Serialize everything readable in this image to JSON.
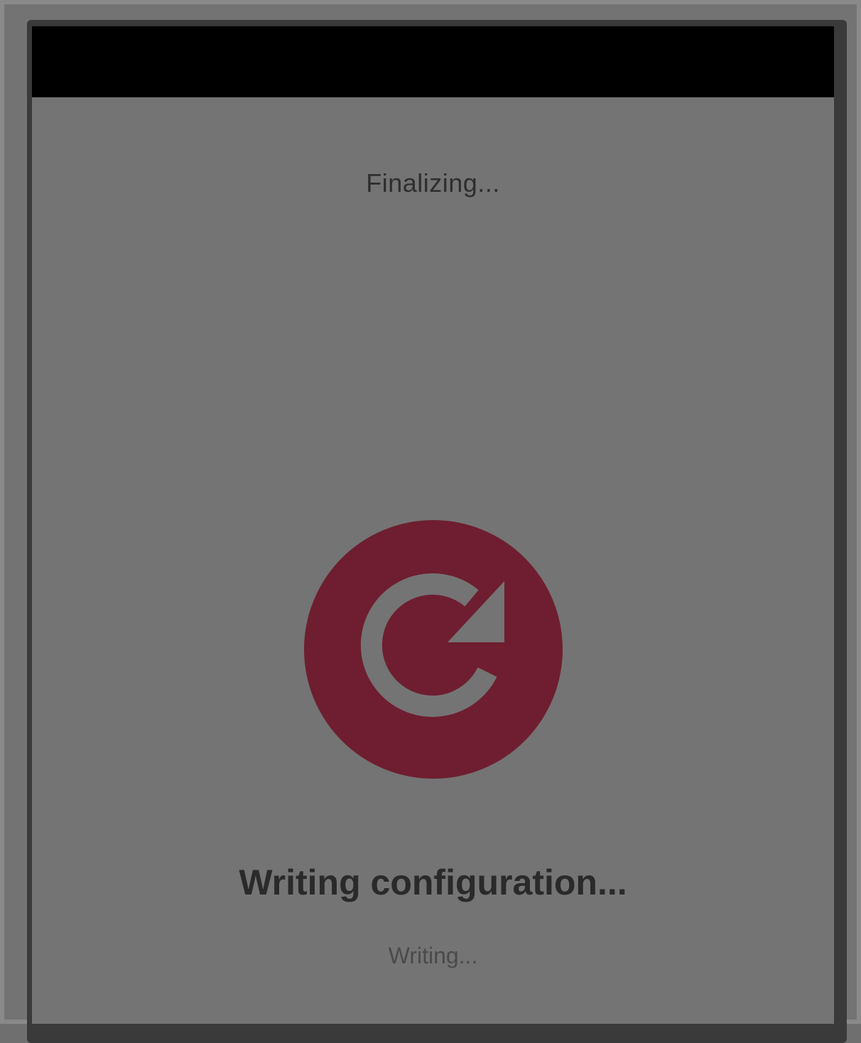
{
  "header": {
    "step_title": "Finalizing..."
  },
  "progress": {
    "icon": "refresh-icon",
    "icon_color": "#6e1e30",
    "heading": "Writing configuration...",
    "status": "Writing..."
  },
  "colors": {
    "status_bar": "#000000",
    "background": "#747474",
    "accent": "#6e1e30"
  }
}
